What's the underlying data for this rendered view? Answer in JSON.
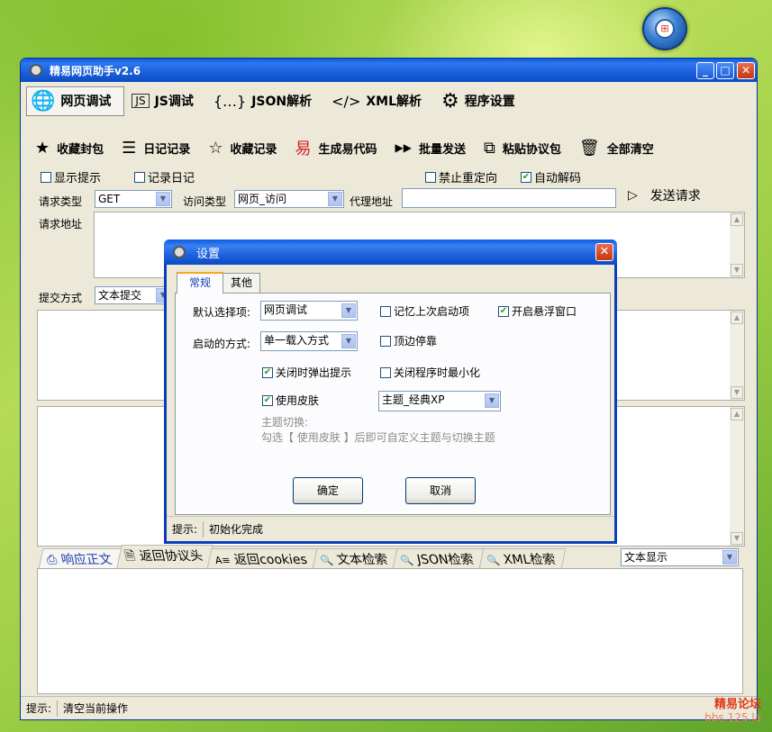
{
  "window": {
    "title": "精易网页助手v2.6",
    "min": "_",
    "max": "□",
    "close": "✕"
  },
  "main_tabs": [
    {
      "label": "网页调试",
      "icon": "🌐"
    },
    {
      "label": "JS调试",
      "icon": "JS"
    },
    {
      "label": "JSON解析",
      "icon": "{…}"
    },
    {
      "label": "XML解析",
      "icon": "</>"
    },
    {
      "label": "程序设置",
      "icon": "⚙"
    }
  ],
  "toolbar": [
    {
      "label": "收藏封包",
      "icon": "★"
    },
    {
      "label": "日记记录",
      "icon": "☰"
    },
    {
      "label": "收藏记录",
      "icon": "☆"
    },
    {
      "label": "生成易代码",
      "icon": "易"
    },
    {
      "label": "批量发送",
      "icon": "▶▶"
    },
    {
      "label": "粘贴协议包",
      "icon": "⧉"
    },
    {
      "label": "全部清空",
      "icon": "🗑"
    }
  ],
  "options": {
    "show_tip": "显示提示",
    "log_diary": "记录日记",
    "no_redirect": "禁止重定向",
    "auto_decode": "自动解码"
  },
  "request": {
    "type_label": "请求类型",
    "type_value": "GET",
    "visit_label": "访问类型",
    "visit_value": "网页_访问",
    "proxy_label": "代理地址",
    "proxy_value": "",
    "send_label": "发送请求",
    "url_label": "请求地址",
    "submit_label": "提交方式",
    "submit_value": "文本提交"
  },
  "response_tabs": [
    "响应正文",
    "返回协议头",
    "返回cookies",
    "文本检索",
    "JSON检索",
    "XML检索"
  ],
  "response_tab_icons": [
    "⎙",
    "🗎",
    "A≡",
    "🔍",
    "🔍",
    "🔍"
  ],
  "display_mode": "文本显示",
  "status": {
    "label": "提示:",
    "text": "清空当前操作"
  },
  "dialog": {
    "title": "设置",
    "close": "✕",
    "tabs": [
      "常规",
      "其他"
    ],
    "default_label": "默认选择项:",
    "default_value": "网页调试",
    "start_label": "启动的方式:",
    "start_value": "单一载入方式",
    "remember": "记忆上次启动项",
    "float_win": "开启悬浮窗口",
    "dock_top": "顶边停靠",
    "close_tip": "关闭时弹出提示",
    "min_on_close": "关闭程序时最小化",
    "use_skin": "使用皮肤",
    "theme_value": "主题_经典XP",
    "theme_hint1": "主题切换:",
    "theme_hint2": "勾选【 使用皮肤 】后即可自定义主题与切换主题",
    "ok": "确定",
    "cancel": "取消",
    "status_label": "提示:",
    "status_text": "初始化完成"
  },
  "watermark": {
    "line1": "精易论坛",
    "line2": "bbs.125.la"
  },
  "colors": {
    "titlebar": "#0a5ad8",
    "window_bg": "#ece9d8",
    "close_red": "#c4380f",
    "active_tab_text": "#1a3cb8"
  }
}
